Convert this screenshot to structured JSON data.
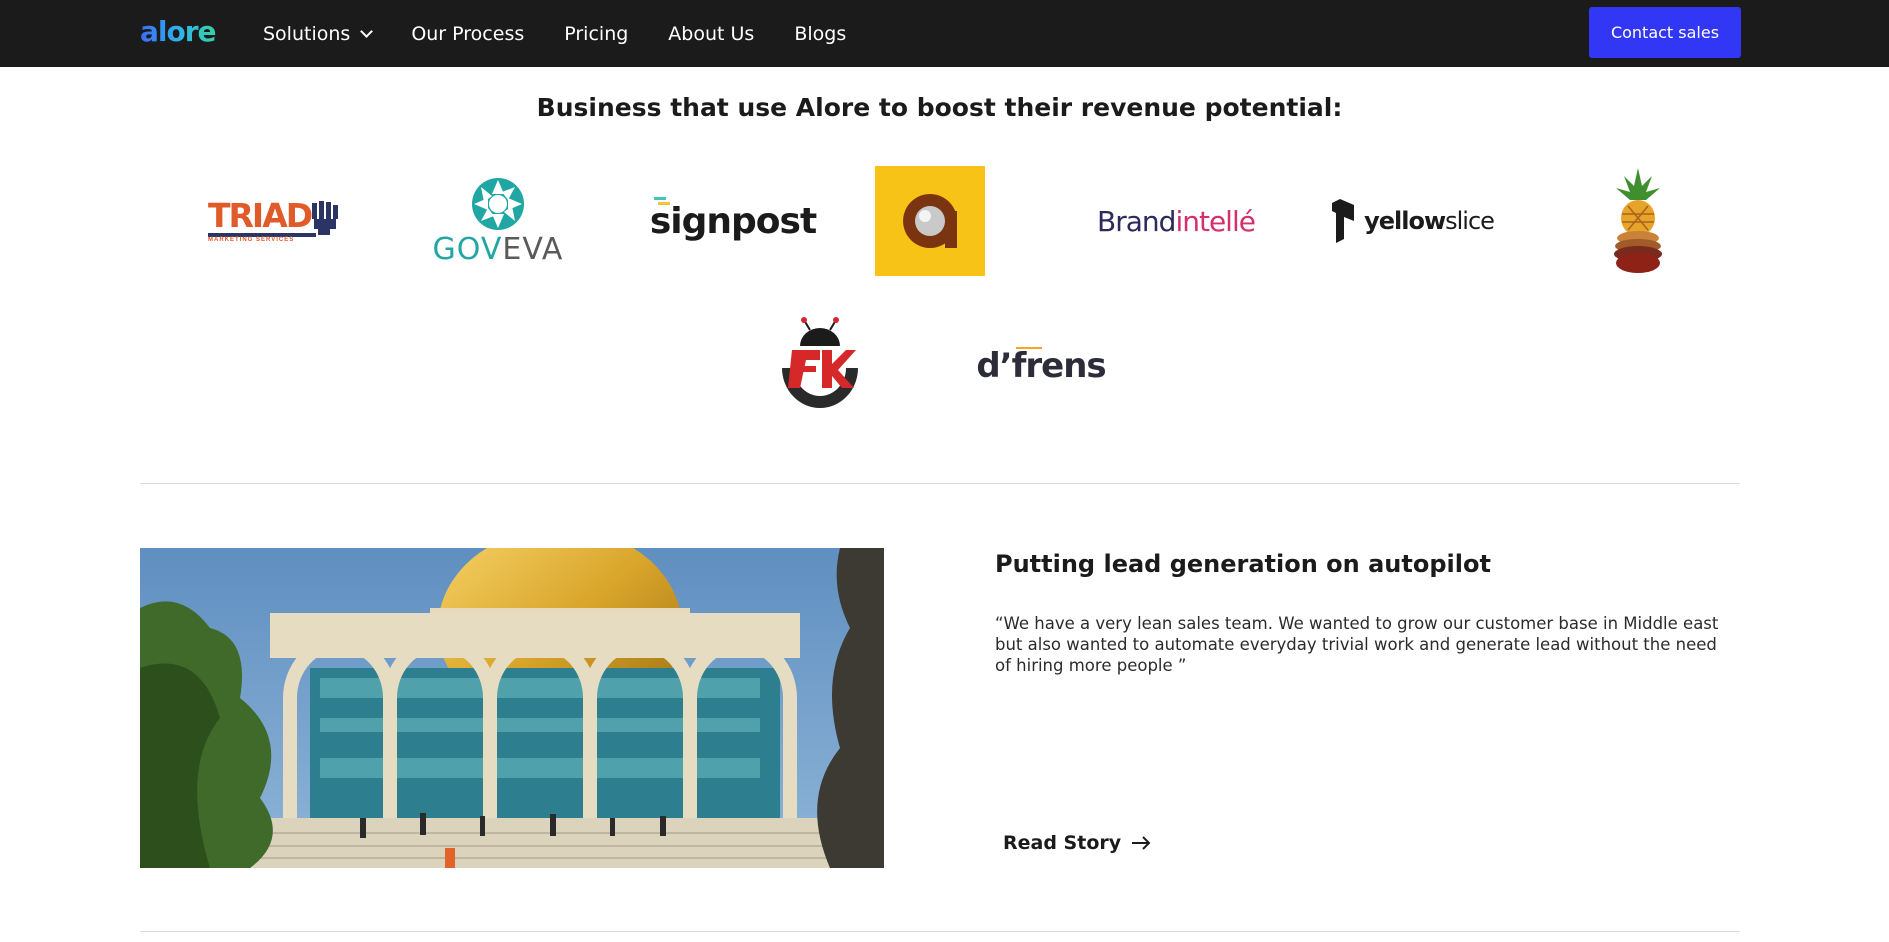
{
  "nav": {
    "logo": "alore",
    "items": [
      {
        "label": "Solutions",
        "has_dropdown": true
      },
      {
        "label": "Our Process"
      },
      {
        "label": "Pricing"
      },
      {
        "label": "About Us"
      },
      {
        "label": "Blogs"
      }
    ],
    "cta_label": "Contact sales",
    "cta_color": "#3137f5"
  },
  "clients": {
    "title": "Business that use Alore to boost their revenue potential:",
    "logos": [
      {
        "name": "TRIAD",
        "text": "TRIAD",
        "subtext": "MARKETING SERVICES"
      },
      {
        "name": "GovEVA",
        "text_a": "GOV",
        "text_b": "EVA"
      },
      {
        "name": "signpost",
        "text": "signpost"
      },
      {
        "name": "alore-a-badge",
        "icon": "a-badge-icon"
      },
      {
        "name": "Brandintellé",
        "text_a": "Brand",
        "text_b": "intellé"
      },
      {
        "name": "yellowslice",
        "text_a": "yellow",
        "text_b": "slice"
      },
      {
        "name": "pineapple",
        "icon": "pineapple-icon"
      },
      {
        "name": "AK",
        "icon": "ak-bug-icon"
      },
      {
        "name": "d'frens",
        "text": "d’frens"
      }
    ]
  },
  "case_study": {
    "title": "Putting lead generation on autopilot",
    "quote": "“We have a very lean sales team. We wanted to grow our customer base in Middle east but also wanted to automate everyday trivial work and generate lead without the need of hiring more people ”",
    "link_label": "Read Story",
    "image_alt": "dome-of-the-rock-photo"
  }
}
